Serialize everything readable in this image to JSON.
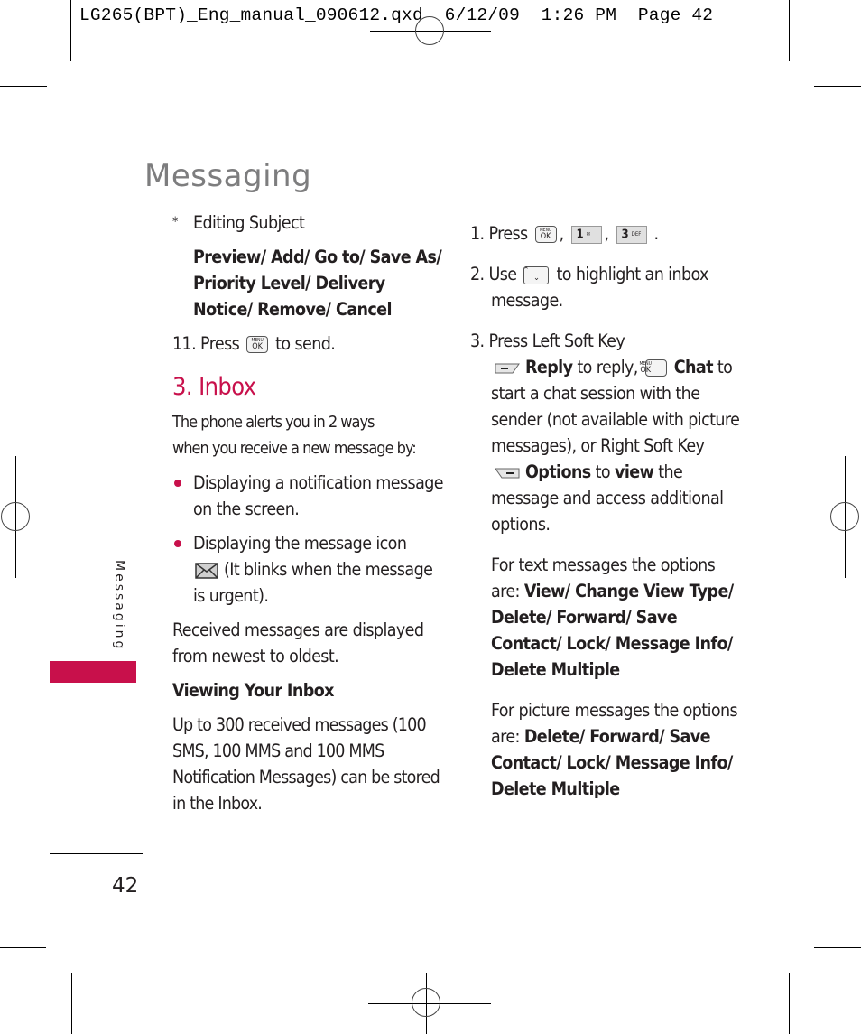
{
  "slug": "LG265(BPT)_Eng_manual_090612.qxd  6/12/09  1:26 PM  Page 42",
  "page_title": "Messaging",
  "side_tab": {
    "label": "Messaging",
    "accent": "#c8104b"
  },
  "page_number": "42",
  "left_column": {
    "editing_subject": {
      "marker": "*",
      "label": "Editing Subject"
    },
    "subject_options": "Preview/ Add/ Go to/ Save As/ Priority Level/ Delivery Notice/ Remove/ Cancel",
    "step11": {
      "prefix": "11. Press",
      "suffix": "to send.",
      "key_icon": "menu-ok-key-icon"
    },
    "section_heading": "3. Inbox",
    "intro_line1": "The phone alerts you in 2 ways",
    "intro_line2": "when you receive a new message by:",
    "bullets": [
      {
        "text": "Displaying a notification message on the screen."
      },
      {
        "text_before": "Displaying the message icon",
        "icon": "envelope-icon",
        "text_after": "(It blinks when the message is urgent)."
      }
    ],
    "order_note": "Received messages are displayed from newest to oldest.",
    "subheading": "Viewing Your Inbox",
    "capacity": "Up to 300 received messages (100 SMS, 100 MMS and 100 MMS Notification Messages) can be stored in the Inbox."
  },
  "right_column": {
    "step1": {
      "prefix": "1. Press",
      "keys": [
        {
          "icon": "menu-ok-key-icon",
          "top": "MENU",
          "main": "OK"
        },
        {
          "icon": "key-1-icon",
          "main": "1",
          "sub": "✉"
        },
        {
          "icon": "key-3-icon",
          "main": "3",
          "sub": "DEF"
        }
      ],
      "separator": ",",
      "end": "."
    },
    "step2": {
      "prefix": "2. Use",
      "key_icon": "nav-key-icon",
      "suffix": "to highlight an inbox message."
    },
    "step3": {
      "prefix": "3. Press Left Soft Key",
      "reply_label": "Reply",
      "reply_suffix": "to reply,",
      "chat_label": "Chat",
      "chat_suffix": "to start a chat session with the sender (not available with picture messages), or Right Soft Key",
      "options_label": "Options",
      "options_suffix": "to",
      "view_label": "view",
      "view_suffix": "the message and access additional options."
    },
    "text_options": {
      "prefix": "For text messages the options are:",
      "options": "View/ Change View Type/ Delete/ Forward/ Save Contact/ Lock/ Message Info/ Delete Multiple"
    },
    "picture_options": {
      "prefix": "For picture messages the options are:",
      "options": "Delete/ Forward/ Save Contact/ Lock/ Message Info/ Delete Multiple"
    }
  }
}
